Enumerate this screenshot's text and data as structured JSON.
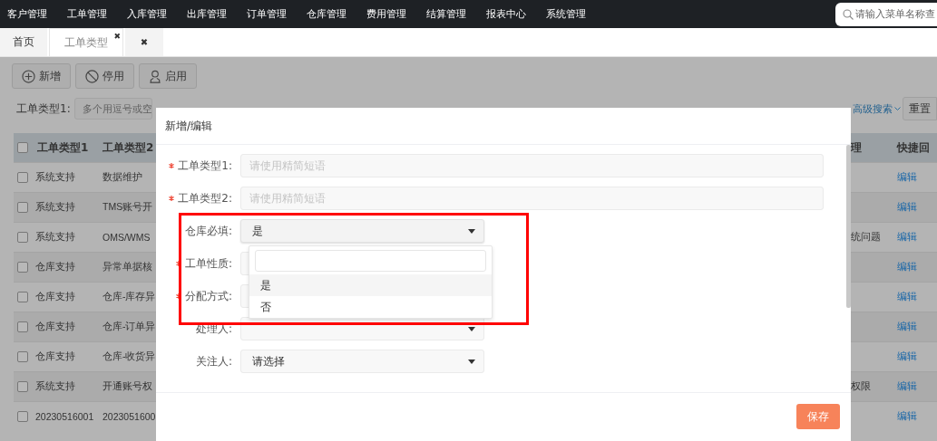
{
  "top_nav": {
    "menu": [
      {
        "label": "客户管理"
      },
      {
        "label": "工单管理"
      },
      {
        "label": "入库管理"
      },
      {
        "label": "出库管理"
      },
      {
        "label": "订单管理"
      },
      {
        "label": "仓库管理"
      },
      {
        "label": "费用管理"
      },
      {
        "label": "结算管理"
      },
      {
        "label": "报表中心"
      },
      {
        "label": "系统管理"
      }
    ],
    "search": {
      "placeholder": "请输入菜单名称查"
    }
  },
  "tabs": [
    {
      "label": "首页",
      "selected": false
    },
    {
      "label": "工单类型",
      "close": "✖",
      "selected": true
    },
    {
      "label": "✖",
      "selected": false
    }
  ],
  "toolbar": [
    {
      "label": "新增",
      "kind": "add"
    },
    {
      "label": "停用",
      "kind": "disable"
    },
    {
      "label": "启用",
      "kind": "enable"
    }
  ],
  "filter": {
    "label": "工单类型1:",
    "placeholder": "多个用逗号或空",
    "advanced_search": "高级搜索",
    "reset": "重置"
  },
  "table": {
    "all_checked": false,
    "columns": [
      "工单类型1",
      "工单类型2",
      "理",
      "快捷回"
    ],
    "rows": [
      {
        "checked": false,
        "cells": [
          "系统支持",
          "数据维护",
          ""
        ],
        "action": "编辑"
      },
      {
        "checked": false,
        "cells": [
          "系统支持",
          "TMS账号开",
          ""
        ],
        "action": "编辑"
      },
      {
        "checked": false,
        "cells": [
          "系统支持",
          "OMS/WMS",
          "统问题"
        ],
        "action": "编辑"
      },
      {
        "checked": false,
        "cells": [
          "仓库支持",
          "异常单据核",
          ""
        ],
        "action": "编辑"
      },
      {
        "checked": false,
        "cells": [
          "仓库支持",
          "仓库-库存异",
          ""
        ],
        "action": "编辑"
      },
      {
        "checked": false,
        "cells": [
          "仓库支持",
          "仓库-订单异",
          ""
        ],
        "action": "编辑"
      },
      {
        "checked": false,
        "cells": [
          "仓库支持",
          "仓库-收货异",
          ""
        ],
        "action": "编辑"
      },
      {
        "checked": false,
        "cells": [
          "系统支持",
          "开通账号权",
          "权限"
        ],
        "action": "编辑"
      },
      {
        "checked": false,
        "cells": [
          "20230516001",
          "2023051600",
          ""
        ],
        "action": "编辑"
      }
    ]
  },
  "modal": {
    "title": "新增/编辑",
    "fields": [
      {
        "label": "工单类型1:",
        "required": true,
        "kind": "input",
        "placeholder": "请使用精简短语"
      },
      {
        "label": "工单类型2:",
        "required": true,
        "kind": "input",
        "placeholder": "请使用精简短语"
      },
      {
        "label": "仓库必填:",
        "required": false,
        "kind": "select",
        "value": "是",
        "open": true,
        "options": [
          {
            "label": "是",
            "selected": true
          },
          {
            "label": "否",
            "selected": false
          }
        ]
      },
      {
        "label": "工单性质:",
        "required": true,
        "kind": "select",
        "open": false
      },
      {
        "label": "分配方式:",
        "required": true,
        "kind": "select",
        "open": false
      },
      {
        "label": "处理人:",
        "required": false,
        "kind": "select",
        "open": false
      },
      {
        "label": "关注人:",
        "required": false,
        "kind": "select",
        "value": "请选择",
        "open": false
      }
    ],
    "save": "保存"
  }
}
